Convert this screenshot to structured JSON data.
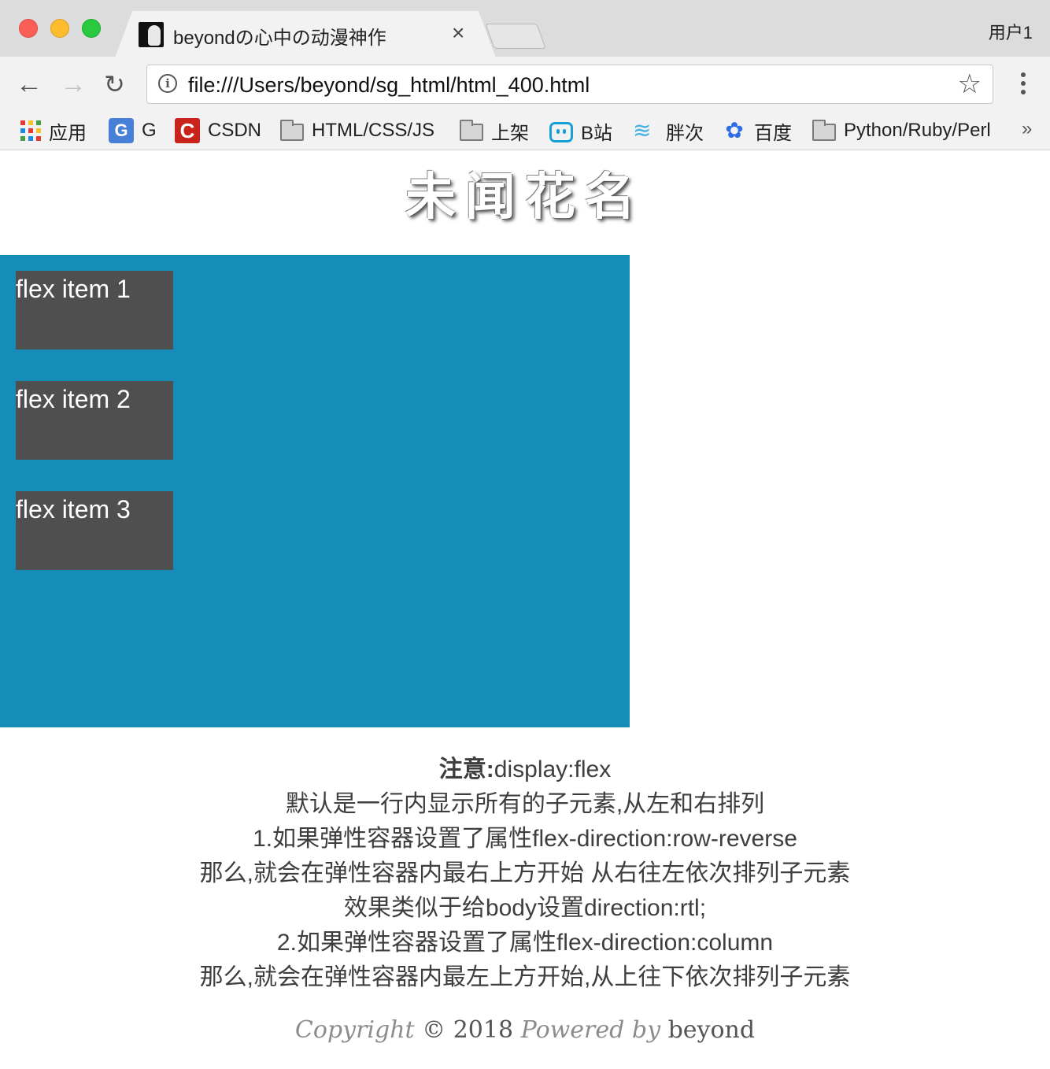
{
  "browser": {
    "tab": {
      "title": "beyondの心中の动漫神作",
      "close_glyph": "×"
    },
    "user_label": "用户1",
    "nav": {
      "back_glyph": "←",
      "forward_glyph": "→",
      "reload_glyph": "↻"
    },
    "omnibox": {
      "info_glyph": "i",
      "url": "file:///Users/beyond/sg_html/html_400.html",
      "star_glyph": "☆"
    },
    "bookmarks": [
      {
        "label": "应用",
        "icon": "apps-grid-icon"
      },
      {
        "label": "G",
        "icon": "google-translate-icon"
      },
      {
        "label": "CSDN",
        "icon": "csdn-icon"
      },
      {
        "label": "HTML/CSS/JS",
        "icon": "folder-icon"
      },
      {
        "label": "上架",
        "icon": "folder-icon"
      },
      {
        "label": "B站",
        "icon": "bilibili-icon"
      },
      {
        "label": "胖次",
        "icon": "pangci-icon"
      },
      {
        "label": "百度",
        "icon": "baidu-icon"
      },
      {
        "label": "Python/Ruby/Perl",
        "icon": "folder-icon"
      }
    ],
    "bookmarks_overflow_glyph": "»",
    "icon_glyphs": {
      "g": "G",
      "csdn": "C",
      "pangci": "≋",
      "baidu": "✿"
    }
  },
  "page": {
    "title": "未闻花名",
    "flex_items": [
      "flex item 1",
      "flex item 2",
      "flex item 3"
    ],
    "notes": {
      "line1_strong": "注意:",
      "line1_rest": "display:flex",
      "line2": "默认是一行内显示所有的子元素,从左和右排列",
      "line3": "1.如果弹性容器设置了属性flex-direction:row-reverse",
      "line4": "那么,就会在弹性容器内最右上方开始 从右往左依次排列子元素",
      "line5": "效果类似于给body设置direction:rtl;",
      "line6": "2.如果弹性容器设置了属性flex-direction:column",
      "line7": "那么,就会在弹性容器内最左上方开始,从上往下依次排列子元素"
    },
    "footer": {
      "copyright": "Copyright",
      "symbol": "©",
      "year": "2018",
      "powered_by": "Powered by",
      "author": "beyond"
    }
  },
  "colors": {
    "flex_container_bg": "#168cb8",
    "flex_item_bg": "#4f4f4f",
    "bookmark_folder": "#7b7b7b"
  }
}
